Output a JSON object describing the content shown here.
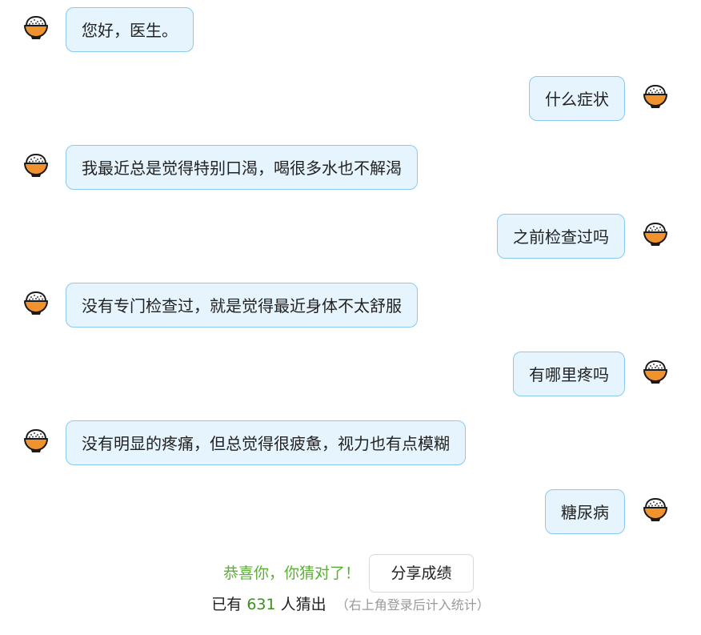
{
  "messages": [
    {
      "side": "left",
      "text": "您好，医生。"
    },
    {
      "side": "right",
      "text": "什么症状"
    },
    {
      "side": "left",
      "text": "我最近总是觉得特别口渴，喝很多水也不解渴"
    },
    {
      "side": "right",
      "text": "之前检查过吗"
    },
    {
      "side": "left",
      "text": "没有专门检查过，就是觉得最近身体不太舒服"
    },
    {
      "side": "right",
      "text": "有哪里疼吗"
    },
    {
      "side": "left",
      "text": "没有明显的疼痛，但总觉得很疲惫，视力也有点模糊"
    },
    {
      "side": "right",
      "text": "糖尿病"
    }
  ],
  "avatar_icon": "rice-bowl-icon",
  "result": {
    "congrats": "恭喜你，你猜对了！",
    "share_label": "分享成绩",
    "stats_prefix": "已有",
    "count": "631",
    "stats_suffix": "人猜出",
    "note": "（右上角登录后计入统计）"
  },
  "colors": {
    "bubble_bg": "#e6f4fd",
    "bubble_border": "#8cc9ef",
    "congrats": "#5ab035",
    "count": "#3e8e1f"
  }
}
